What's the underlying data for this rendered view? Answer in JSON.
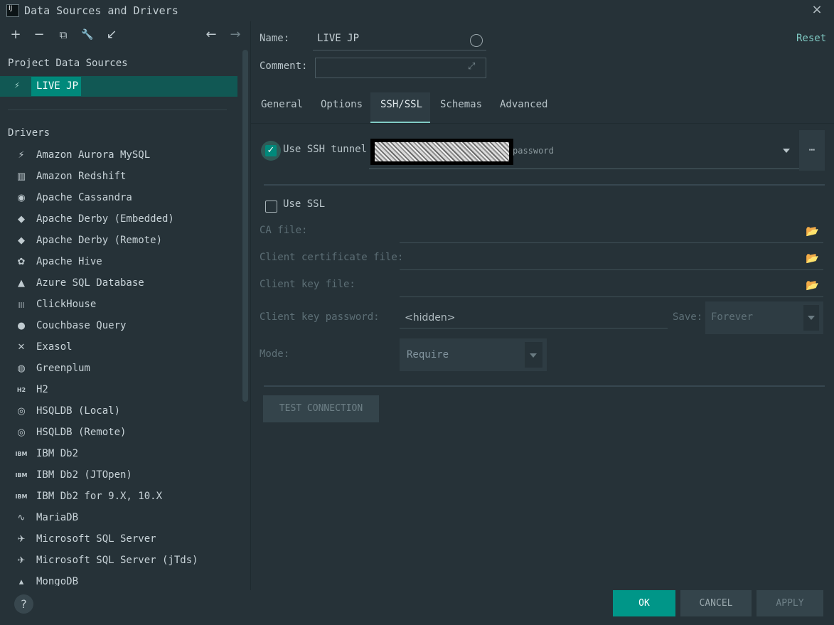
{
  "window": {
    "title": "Data Sources and Drivers",
    "close_icon": "×"
  },
  "toolbar": {
    "add": "+",
    "remove": "−",
    "copy": "⧉",
    "wrench": "🔧",
    "import": "↙",
    "back": "←",
    "forward": "→"
  },
  "left": {
    "project_heading": "Project Data Sources",
    "selected_source": "LIVE JP",
    "drivers_heading": "Drivers",
    "drivers": [
      {
        "label": "Amazon Aurora MySQL",
        "icon": "⚡"
      },
      {
        "label": "Amazon Redshift",
        "icon": "▥"
      },
      {
        "label": "Apache Cassandra",
        "icon": "◉"
      },
      {
        "label": "Apache Derby (Embedded)",
        "icon": "◆"
      },
      {
        "label": "Apache Derby (Remote)",
        "icon": "◆"
      },
      {
        "label": "Apache Hive",
        "icon": "✿"
      },
      {
        "label": "Azure SQL Database",
        "icon": "▲"
      },
      {
        "label": "ClickHouse",
        "icon": "|||"
      },
      {
        "label": "Couchbase Query",
        "icon": "●"
      },
      {
        "label": "Exasol",
        "icon": "✕"
      },
      {
        "label": "Greenplum",
        "icon": "◍"
      },
      {
        "label": "H2",
        "icon": "H2"
      },
      {
        "label": "HSQLDB (Local)",
        "icon": "◎"
      },
      {
        "label": "HSQLDB (Remote)",
        "icon": "◎"
      },
      {
        "label": "IBM Db2",
        "icon": "IBM"
      },
      {
        "label": "IBM Db2 (JTOpen)",
        "icon": "IBM"
      },
      {
        "label": "IBM Db2 for 9.X, 10.X",
        "icon": "IBM"
      },
      {
        "label": "MariaDB",
        "icon": "∿"
      },
      {
        "label": "Microsoft SQL Server",
        "icon": "✈"
      },
      {
        "label": "Microsoft SQL Server (jTds)",
        "icon": "✈"
      },
      {
        "label": "MongoDB",
        "icon": "▴"
      }
    ],
    "help": "?"
  },
  "form": {
    "name_label": "Name:",
    "name_value": "LIVE JP",
    "comment_label": "Comment:",
    "reset": "Reset"
  },
  "tabs": [
    "General",
    "Options",
    "SSH/SSL",
    "Schemas",
    "Advanced"
  ],
  "active_tab": "SSH/SSL",
  "ssh": {
    "use_ssh_label": "Use SSH tunnel",
    "use_ssh_checked": true,
    "tunnel_hint": "password",
    "more": "⋯"
  },
  "ssl": {
    "use_ssl_label": "Use SSL",
    "use_ssl_checked": false,
    "ca_file_label": "CA file:",
    "client_cert_label": "Client certificate file:",
    "client_key_label": "Client key file:",
    "client_key_password_label": "Client key password:",
    "client_key_password_value": "<hidden>",
    "save_label": "Save:",
    "save_value": "Forever",
    "mode_label": "Mode:",
    "mode_value": "Require"
  },
  "test_connection": "TEST CONNECTION",
  "buttons": {
    "ok": "OK",
    "cancel": "CANCEL",
    "apply": "APPLY"
  }
}
